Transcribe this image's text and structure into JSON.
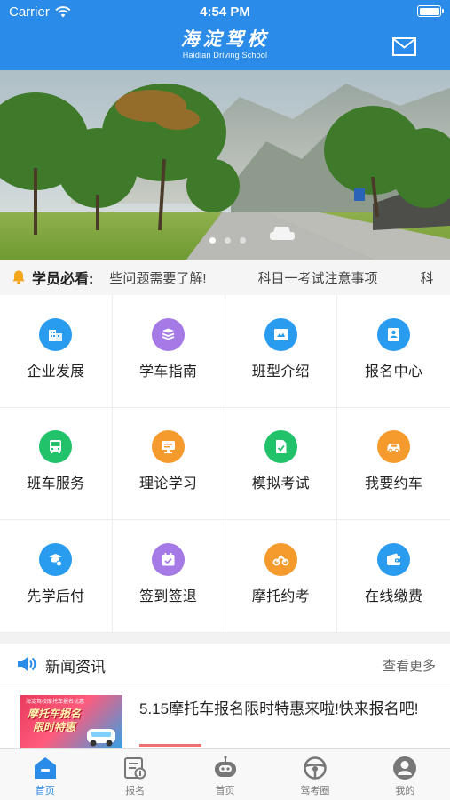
{
  "status_bar": {
    "carrier": "Carrier",
    "time": "4:54 PM"
  },
  "header": {
    "title_cn": "海淀驾校",
    "title_en": "Haidian Driving School",
    "mail_icon": "mail-icon"
  },
  "banner": {
    "dots": 3,
    "active_dot": 0
  },
  "notice": {
    "title": "学员必看:",
    "messages": [
      "些问题需要了解!",
      "科目一考试注意事项",
      "科"
    ]
  },
  "grid_items": [
    {
      "label": "企业发展",
      "icon": "building-icon",
      "color": "#2a9cf0"
    },
    {
      "label": "学车指南",
      "icon": "book-stack-icon",
      "color": "#a57ae6"
    },
    {
      "label": "班型介绍",
      "icon": "class-card-icon",
      "color": "#2a9cf0"
    },
    {
      "label": "报名中心",
      "icon": "registration-icon",
      "color": "#2a9cf0"
    },
    {
      "label": "班车服务",
      "icon": "bus-icon",
      "color": "#22c26b"
    },
    {
      "label": "理论学习",
      "icon": "screen-icon",
      "color": "#f59a2c"
    },
    {
      "label": "模拟考试",
      "icon": "exam-paper-icon",
      "color": "#22c26b"
    },
    {
      "label": "我要约车",
      "icon": "car-icon",
      "color": "#f59a2c"
    },
    {
      "label": "先学后付",
      "icon": "study-pay-icon",
      "color": "#2a9cf0"
    },
    {
      "label": "签到签退",
      "icon": "calendar-check-icon",
      "color": "#a57ae6"
    },
    {
      "label": "摩托约考",
      "icon": "motorcycle-icon",
      "color": "#f59a2c"
    },
    {
      "label": "在线缴费",
      "icon": "wallet-icon",
      "color": "#2a9cf0"
    }
  ],
  "news": {
    "section_title": "新闻资讯",
    "more": "查看更多",
    "items": [
      {
        "title": "5.15摩托车报名限时特惠来啦!快来报名吧!",
        "thumb_caption": "海淀驾校摩托车报名优惠",
        "thumb_headline": "摩托车报名限时特惠"
      }
    ]
  },
  "tabs": [
    {
      "label": "首页",
      "icon": "home-icon",
      "active": true
    },
    {
      "label": "报名",
      "icon": "signup-icon",
      "active": false
    },
    {
      "label": "首页",
      "icon": "robot-icon",
      "active": false
    },
    {
      "label": "驾考圈",
      "icon": "steering-wheel-icon",
      "active": false
    },
    {
      "label": "我的",
      "icon": "profile-icon",
      "active": false
    }
  ],
  "colors": {
    "primary": "#2b8be8",
    "tab_inactive": "#7a7a7a"
  }
}
